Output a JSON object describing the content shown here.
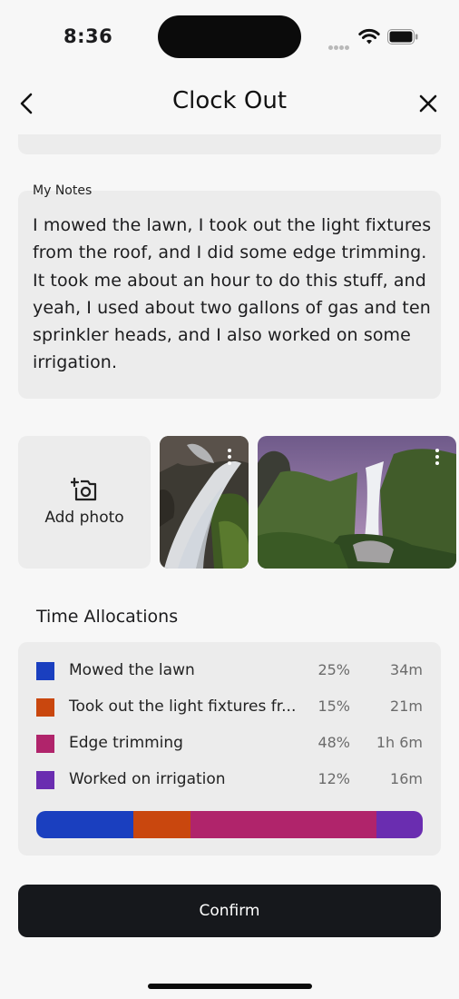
{
  "status_bar": {
    "time": "8:36"
  },
  "header": {
    "title": "Clock Out"
  },
  "notes": {
    "label": "My Notes",
    "text": "I mowed the lawn, I took out the light fixtures from the roof, and I did some edge trimming. It took me about an hour to do this stuff, and yeah, I used about two gallons of gas and ten sprinkler heads, and I also worked on some irrigation."
  },
  "photos": {
    "add_label": "Add photo"
  },
  "allocations": {
    "title": "Time Allocations",
    "items": [
      {
        "name": "Mowed the lawn",
        "percent": "25%",
        "duration": "34m",
        "color": "#1a3fbf",
        "share": 25
      },
      {
        "name": "Took out the light fixtures fr...",
        "percent": "15%",
        "duration": "21m",
        "color": "#c9470e",
        "share": 15
      },
      {
        "name": "Edge trimming",
        "percent": "48%",
        "duration": "1h 6m",
        "color": "#b0246b",
        "share": 48
      },
      {
        "name": "Worked on irrigation",
        "percent": "12%",
        "duration": "16m",
        "color": "#6a2db0",
        "share": 12
      }
    ]
  },
  "footer": {
    "confirm_label": "Confirm"
  }
}
